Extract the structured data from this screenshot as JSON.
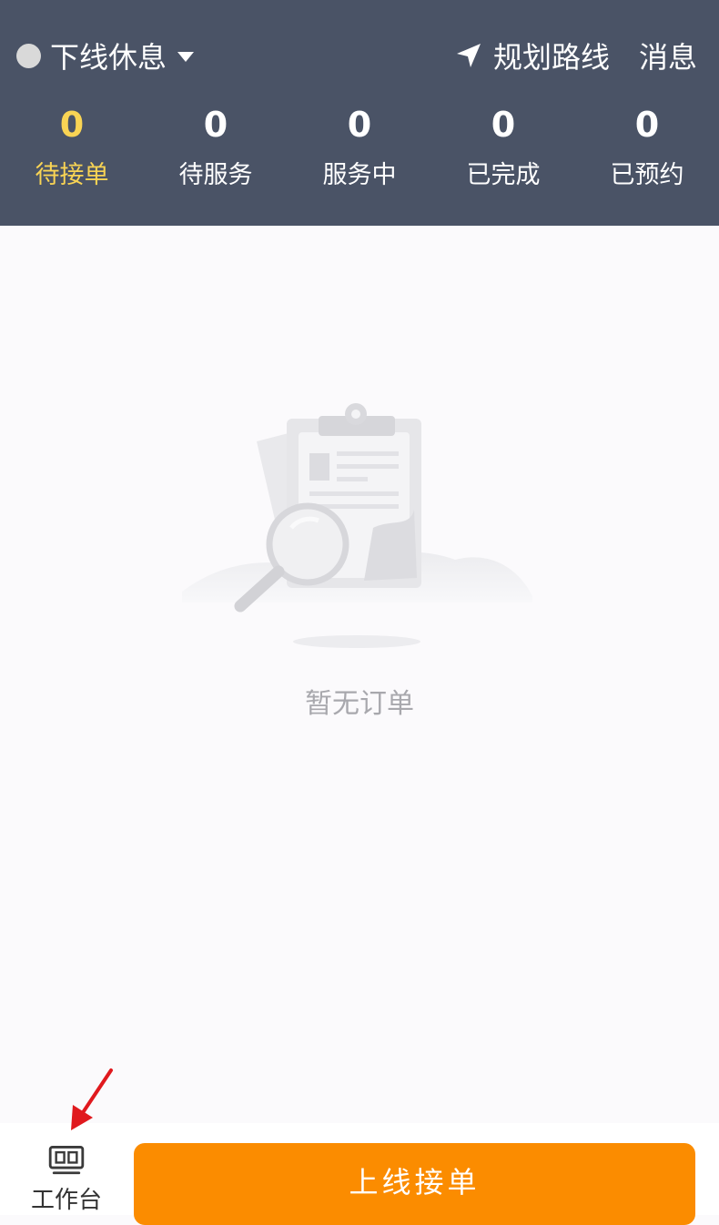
{
  "header": {
    "status_label": "下线休息",
    "route_label": "规划路线",
    "message_label": "消息",
    "stats": [
      {
        "count": "0",
        "label": "待接单",
        "active": true
      },
      {
        "count": "0",
        "label": "待服务",
        "active": false
      },
      {
        "count": "0",
        "label": "服务中",
        "active": false
      },
      {
        "count": "0",
        "label": "已完成",
        "active": false
      },
      {
        "count": "0",
        "label": "已预约",
        "active": false
      }
    ]
  },
  "empty_state": {
    "text": "暂无订单"
  },
  "bottom_bar": {
    "workbench_label": "工作台",
    "online_button_label": "上线接单"
  },
  "icons": {
    "status": "status-dot-icon",
    "caret": "caret-down-icon",
    "route": "navigation-arrow-icon",
    "workbench": "workbench-icon",
    "illustration": "empty-clipboard-icon"
  },
  "colors": {
    "header_bg": "#4a5366",
    "active_tab": "#f9d454",
    "primary_button": "#fb8c00",
    "annotation_arrow": "#e0191e"
  }
}
